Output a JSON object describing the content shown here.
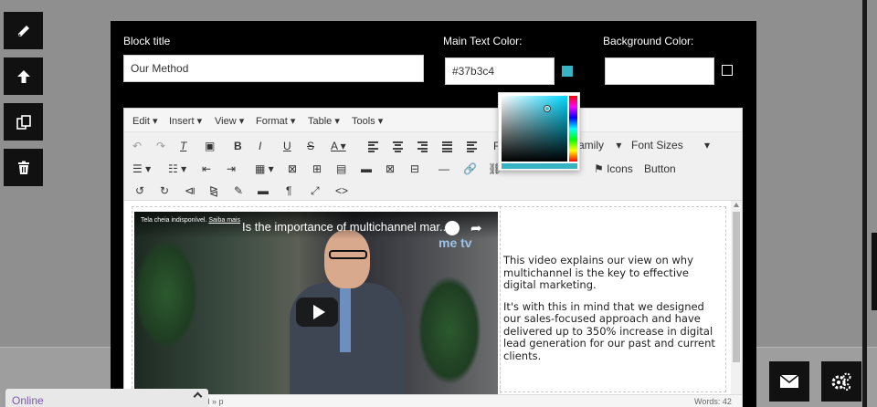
{
  "modal": {
    "block_title_label": "Block title",
    "block_title_value": "Our Method",
    "main_text_color_label": "Main Text Color:",
    "main_text_color_value": "#37b3c4",
    "background_color_label": "Background Color:",
    "background_color_value": ""
  },
  "colors": {
    "main_text_swatch": "#37b3c4",
    "picker_hue": "#00d7ff"
  },
  "editor": {
    "menu": [
      "Edit",
      "Insert",
      "View",
      "Format",
      "Table",
      "Tools"
    ],
    "toolbar": {
      "font_family_fragment": "amily",
      "font_sizes": "Font Sizes",
      "icons_label": "Icons",
      "button_label": "Button"
    },
    "video": {
      "overlay_text": "Tela cheia indisponível.",
      "overlay_link": "Saiba mais",
      "title": "Is the importance of multichannel mar...",
      "logo": "me tv"
    },
    "paragraphs": [
      "This video explains our view on why multichannel is the key to effective digital marketing.",
      "It's with this in mind that we designed our sales-focused approach and have delivered up to 350% increase in digital lead generation for our past and current clients."
    ],
    "status_left": "td » p",
    "status_words": "Words: 42"
  },
  "chat": {
    "label": "Online"
  },
  "icons": {
    "side": [
      "pencil-icon",
      "arrow-up-icon",
      "copy-icon",
      "trash-icon"
    ],
    "corner": [
      "envelope-icon",
      "gears-icon"
    ]
  }
}
